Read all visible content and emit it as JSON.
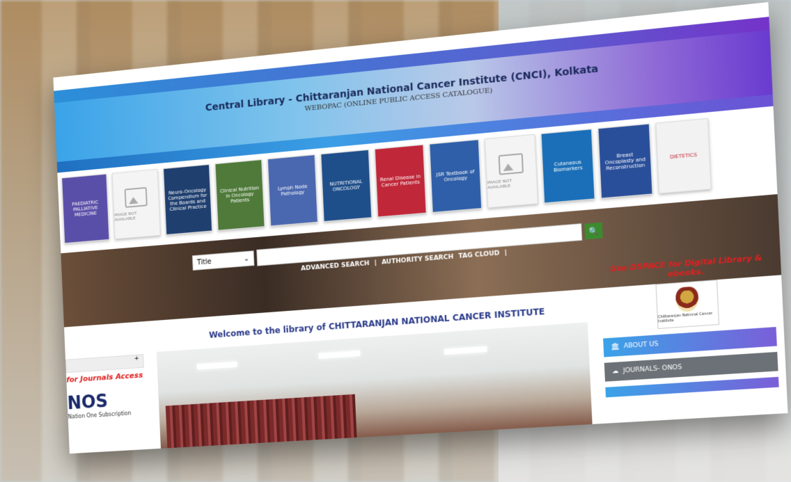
{
  "header": {
    "title": "Central Library - Chittaranjan National Cancer Institute (CNCI), Kolkata",
    "subtitle": "WEBOPAC (ONLINE PUBLIC ACCESS CATALOGUE)"
  },
  "books": [
    {
      "title": "PAEDIATRIC PALLIATIVE MEDICINE",
      "color": "#5a4fa8"
    },
    {
      "title": "IMAGE NOT AVAILABLE",
      "na": true
    },
    {
      "title": "Neuro-Oncology Compendium for the Boards and Clinical Practice",
      "color": "#1f3f6f"
    },
    {
      "title": "Clinical Nutrition in Oncology Patients",
      "color": "#4f7a3a"
    },
    {
      "title": "Lymph Node Pathology",
      "color": "#4a68b0"
    },
    {
      "title": "NUTRITIONAL ONCOLOGY",
      "color": "#1f4f8a"
    },
    {
      "title": "Renal Disease in Cancer Patients",
      "color": "#c0283a"
    },
    {
      "title": "JSR Textbook of Oncology",
      "color": "#2f5fa8"
    },
    {
      "title": "IMAGE NOT AVAILABLE",
      "na": true
    },
    {
      "title": "Cutaneous Biomarkers",
      "color": "#1a6fb8"
    },
    {
      "title": "Breast Oncoplasty and Reconstruction",
      "color": "#2a4f9a"
    },
    {
      "title": "DIETETICS",
      "color": "#f2f2f2"
    }
  ],
  "search": {
    "select_value": "Title",
    "button_label": "🔍",
    "links": [
      "ADVANCED SEARCH",
      "|",
      "AUTHORITY SEARCH",
      "TAG CLOUD",
      "|"
    ]
  },
  "main": {
    "welcome": "Welcome to the library of CHITTARANJAN NATIONAL CANCER INSTITUTE"
  },
  "left": {
    "journals_text": "for Journals Access",
    "onos": "NOS",
    "onos_sub": "Nation One Subscription"
  },
  "right": {
    "dspace": "Use DSPACE for Digital Library & ebooks.",
    "logo_caption": "Chittaranjan National Cancer Institute",
    "about": "ABOUT US",
    "journals": "JOURNALS- ONOS"
  }
}
